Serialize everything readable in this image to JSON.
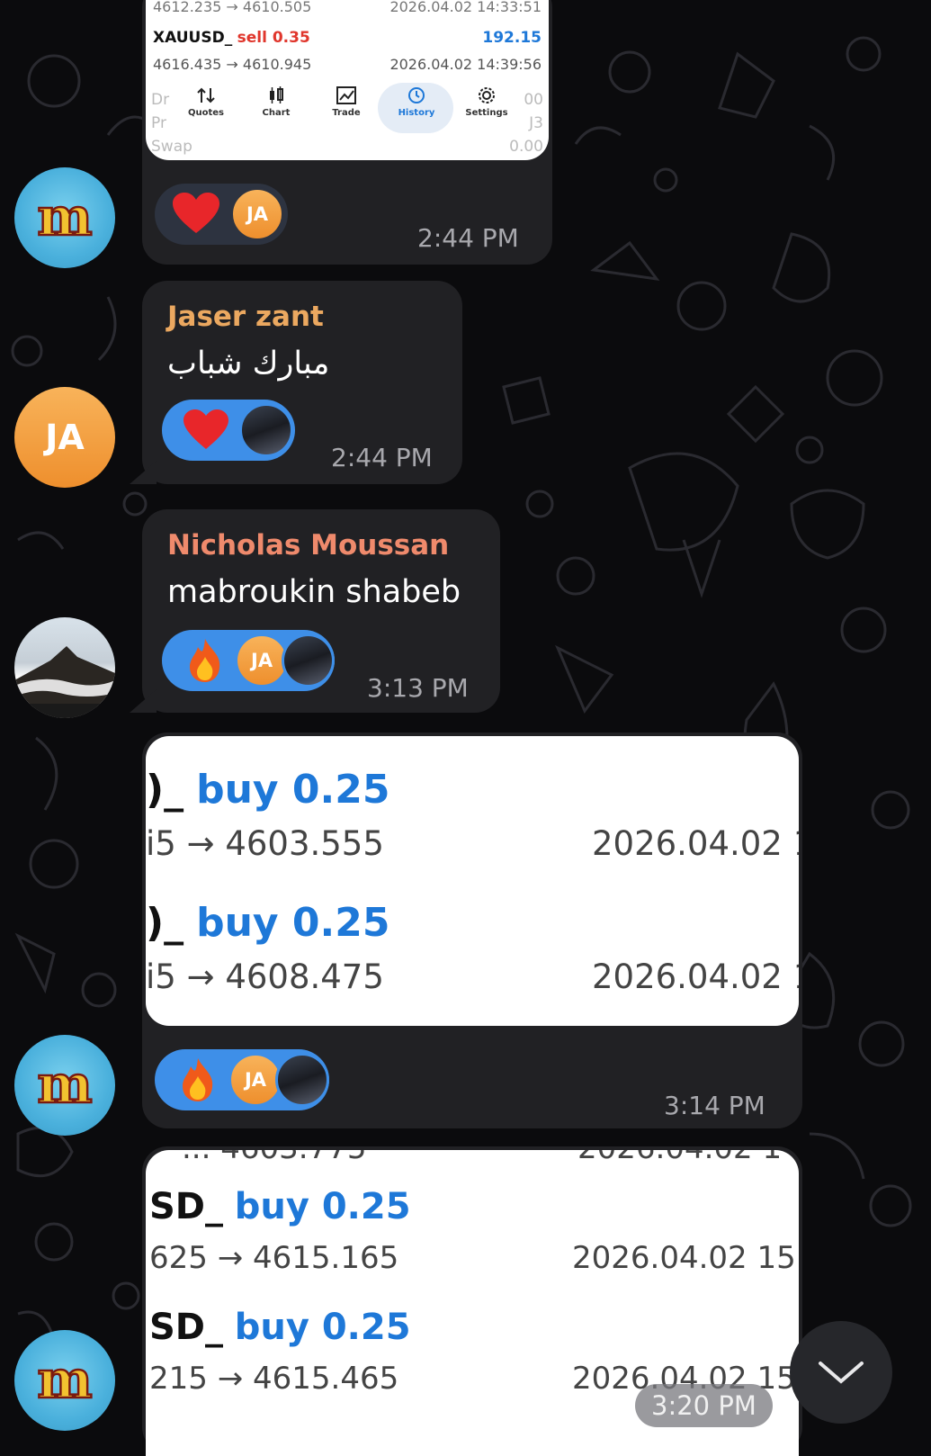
{
  "messages": {
    "screenshot1": {
      "row0": {
        "range": "4612.235 → 4610.505",
        "date": "2026.04.02 14:33:51"
      },
      "row1": {
        "symbol": "XAUUSD_",
        "side": "sell 0.35",
        "profit": "192.15",
        "range": "4616.435 → 4610.945",
        "date": "2026.04.02 14:39:56"
      },
      "partial_left": [
        "Dr",
        "Pr",
        "Swap"
      ],
      "partial_right": [
        "00",
        "J3",
        "0.00"
      ],
      "tabs": [
        {
          "label": "Quotes",
          "icon": "quotes-arrows-icon"
        },
        {
          "label": "Chart",
          "icon": "candlestick-icon"
        },
        {
          "label": "Trade",
          "icon": "trade-chart-icon"
        },
        {
          "label": "History",
          "icon": "history-clock-icon"
        },
        {
          "label": "Settings",
          "icon": "settings-gear-icon"
        }
      ],
      "reaction_avatar": "JA",
      "time": "2:44 PM"
    },
    "jaser": {
      "sender": "Jaser zant",
      "text": "مبارك شباب",
      "time": "2:44 PM",
      "avatar": "JA"
    },
    "nicholas": {
      "sender": "Nicholas Moussan",
      "text": "mabroukin shabeb",
      "time": "3:13 PM",
      "reaction_avatar": "JA"
    },
    "screenshot2": {
      "rows": [
        {
          "symbol": ")_",
          "side": "buy 0.25",
          "range": "i5 → 4603.555",
          "date": "2026.04.02 1"
        },
        {
          "symbol": ")_",
          "side": "buy 0.25",
          "range": "i5 → 4608.475",
          "date": "2026.04.02 1"
        }
      ],
      "reaction_avatar": "JA",
      "time": "3:14 PM"
    },
    "screenshot3": {
      "top_cut_left": "... 4603.775",
      "top_cut_right": "2026.04.02 1",
      "rows": [
        {
          "symbol": "SD_",
          "side": "buy 0.25",
          "range": "625 → 4615.165",
          "date": "2026.04.02 15:"
        },
        {
          "symbol": "SD_",
          "side": "buy 0.25",
          "range": "215 → 4615.465",
          "date": "2026.04.02 15:"
        }
      ],
      "time": "3:20 PM"
    }
  },
  "colors": {
    "background": "#0b0b0d",
    "bubble": "#212124",
    "reaction_blue": "#3e8fe8",
    "name_jaser": "#eba860",
    "name_nicholas": "#ef8a6c",
    "trade_blue": "#1e78d8",
    "trade_red": "#e0362c"
  }
}
